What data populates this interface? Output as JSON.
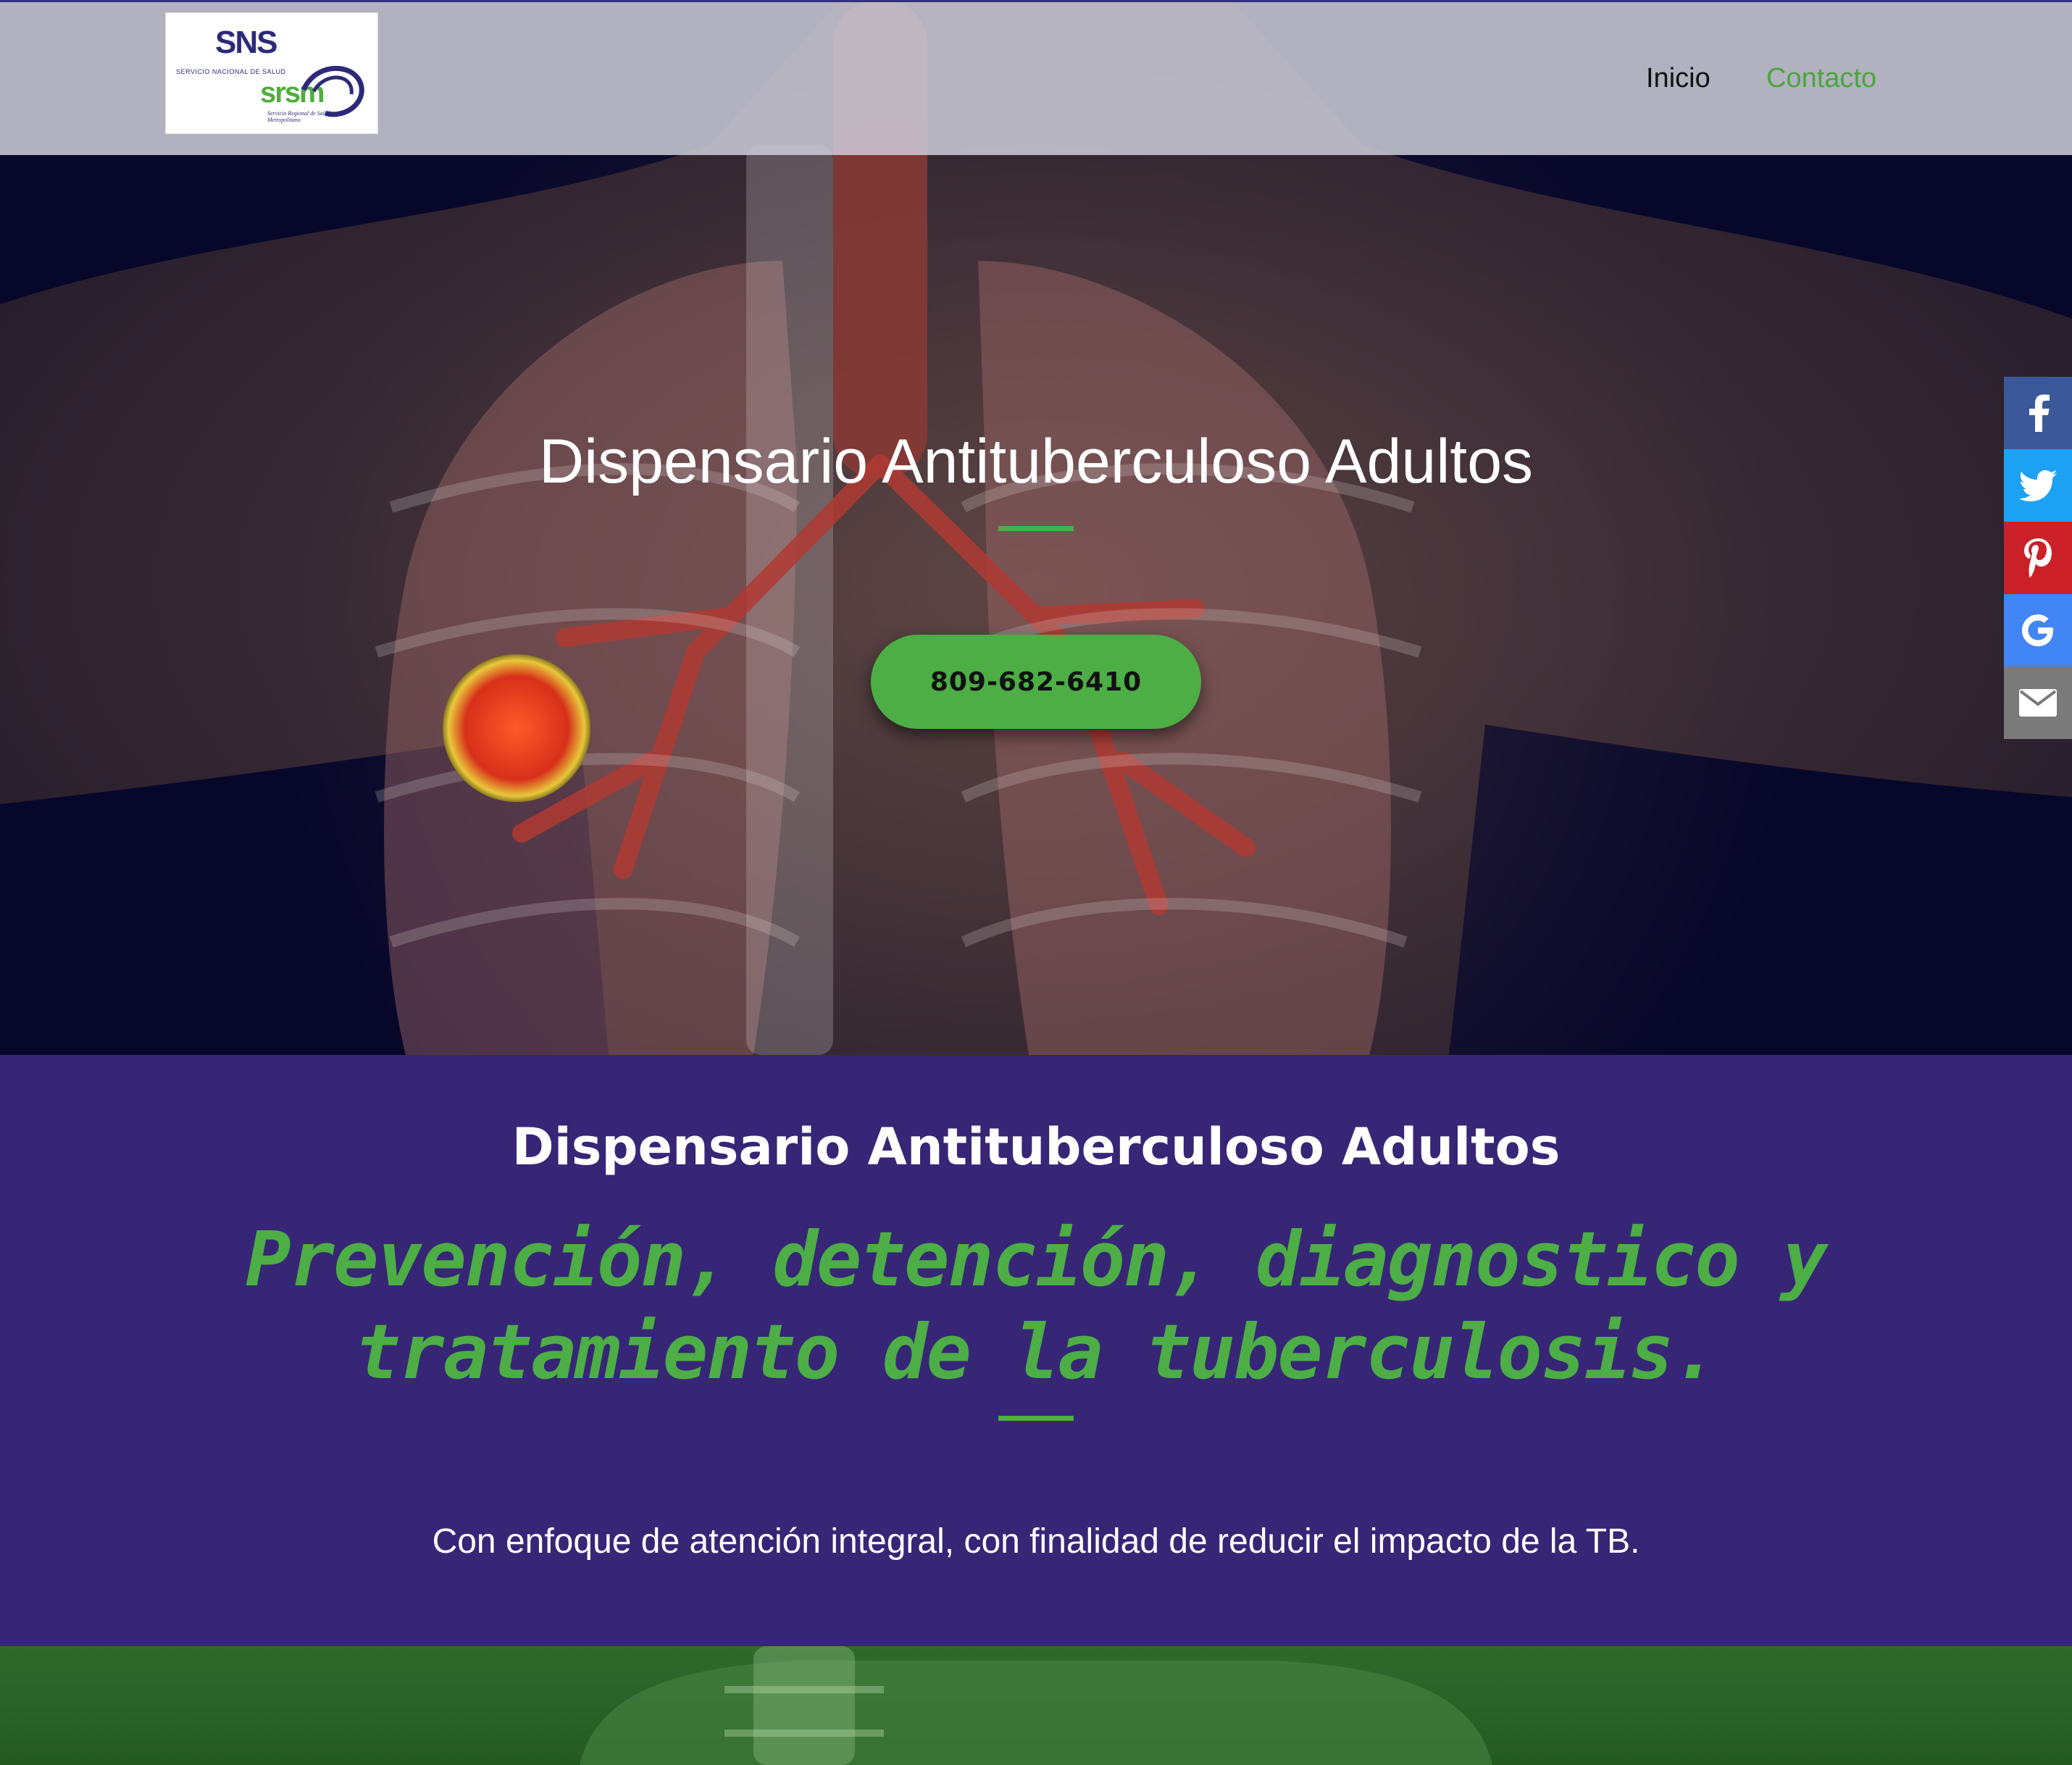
{
  "logo": {
    "sns": "SNS",
    "sns_sub": "SERVICIO NACIONAL DE SALUD",
    "srsm": "srsm",
    "srsm_sub": "Servicio Regional de Salud Metropolitano"
  },
  "nav": {
    "inicio": "Inicio",
    "contacto": "Contacto"
  },
  "hero": {
    "title": "Dispensario Antituberculoso Adultos",
    "phone_button": "809-682-6410"
  },
  "social": [
    "facebook-icon",
    "twitter-icon",
    "pinterest-icon",
    "google-icon",
    "email-icon"
  ],
  "about": {
    "title": "Dispensario Antituberculoso Adultos",
    "tagline": "Prevención, detención, diagnostico y tratamiento de la tuberculosis.",
    "body": "Con enfoque de atención integral, con finalidad de reducir el impacto de la TB."
  },
  "colors": {
    "accent_green": "#4cae45",
    "purple": "#372676",
    "facebook": "#3b5998",
    "twitter": "#1da1f2",
    "pinterest": "#cb2027",
    "google": "#4285f4",
    "email": "#7a7a7a"
  }
}
